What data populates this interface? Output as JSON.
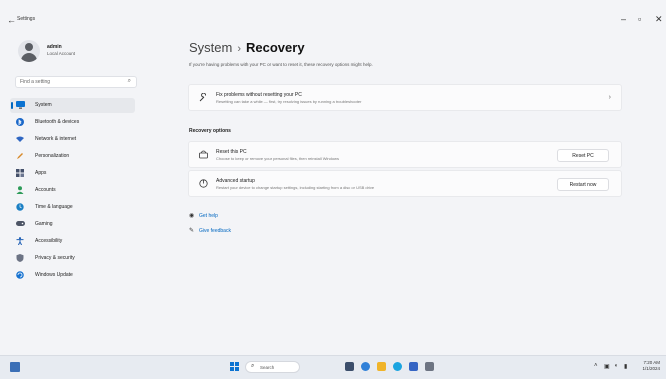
{
  "window": {
    "title": "Settings",
    "back_glyph": "←",
    "minimize_glyph": "–",
    "maximize_glyph": "▫",
    "close_glyph": "✕"
  },
  "profile": {
    "name": "admin",
    "account_type": "Local Account"
  },
  "search": {
    "placeholder": "Find a setting",
    "icon": "search-icon"
  },
  "sidebar": {
    "items": [
      {
        "label": "System",
        "icon": "monitor-icon",
        "selected": true
      },
      {
        "label": "Bluetooth & devices",
        "icon": "bluetooth-icon"
      },
      {
        "label": "Network & internet",
        "icon": "wifi-icon"
      },
      {
        "label": "Personalization",
        "icon": "pencil-icon"
      },
      {
        "label": "Apps",
        "icon": "apps-icon"
      },
      {
        "label": "Accounts",
        "icon": "person-icon"
      },
      {
        "label": "Time & language",
        "icon": "globe-clock-icon"
      },
      {
        "label": "Gaming",
        "icon": "gamepad-icon"
      },
      {
        "label": "Accessibility",
        "icon": "accessibility-icon"
      },
      {
        "label": "Privacy & security",
        "icon": "shield-icon"
      },
      {
        "label": "Windows Update",
        "icon": "update-icon"
      }
    ]
  },
  "main": {
    "breadcrumb_parent": "System",
    "breadcrumb_sep": "›",
    "breadcrumb_current": "Recovery",
    "description": "If you're having problems with your PC or want to reset it, these recovery options might help.",
    "fix_card": {
      "title": "Fix problems without resetting your PC",
      "subtitle": "Resetting can take a while — first, try resolving issues by running a troubleshooter"
    },
    "recovery_header": "Recovery options",
    "reset_card": {
      "title": "Reset this PC",
      "subtitle": "Choose to keep or remove your personal files, then reinstall Windows",
      "button": "Reset PC"
    },
    "advanced_card": {
      "title": "Advanced startup",
      "subtitle": "Restart your device to change startup settings, including starting from a disc or USB drive",
      "button": "Restart now"
    },
    "links": {
      "help": "Get help",
      "feedback": "Give feedback"
    }
  },
  "taskbar": {
    "search_label": "Search",
    "time": "7:20 AM",
    "date": "1/1/2024"
  },
  "colors": {
    "accent": "#0067c0",
    "background": "#f3f4f7",
    "card": "#fbfbfc"
  }
}
